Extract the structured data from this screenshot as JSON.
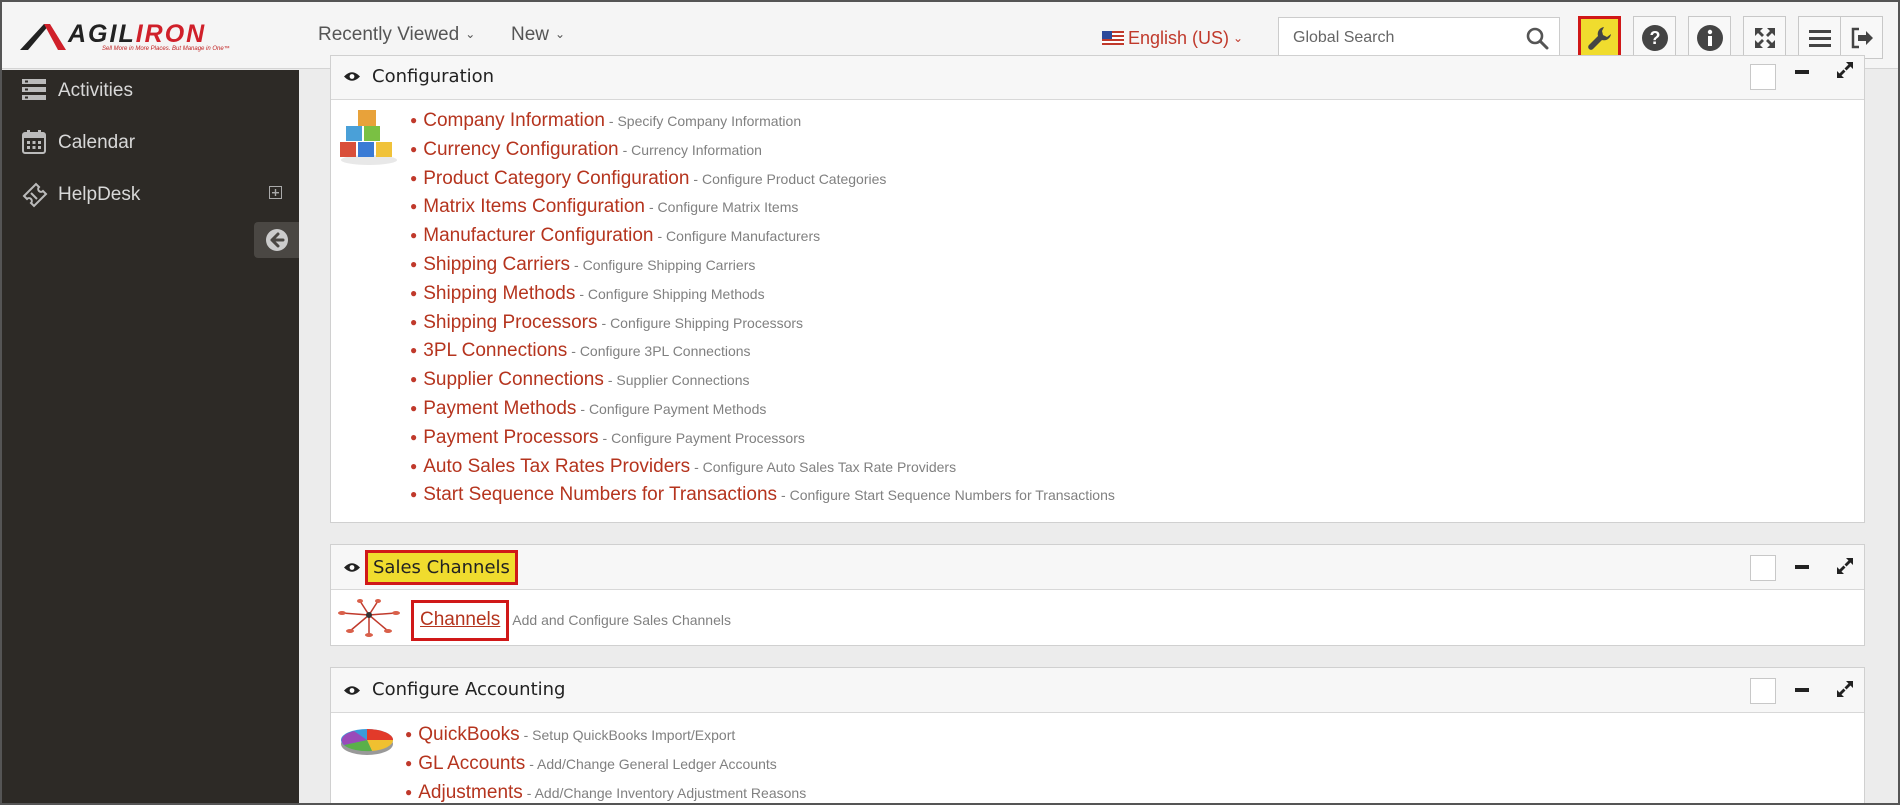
{
  "brand": {
    "name_part1": "AGIL",
    "name_part2": "IRON",
    "tagline": "Sell More in More Places. But Manage in One™"
  },
  "topbar": {
    "recently_viewed": "Recently Viewed",
    "new_label": "New",
    "language": "English (US)",
    "search_placeholder": "Global Search",
    "buttons": [
      "settings-wrench",
      "help",
      "info",
      "fullscreen",
      "menu",
      "logout"
    ]
  },
  "sidebar": {
    "items": [
      {
        "label": "Activities",
        "icon": "activities-icon"
      },
      {
        "label": "Calendar",
        "icon": "calendar-icon"
      },
      {
        "label": "HelpDesk",
        "icon": "ticket-icon"
      }
    ]
  },
  "panels": {
    "configuration": {
      "title": "Configuration",
      "items": [
        {
          "link": "Company Information",
          "desc": "- Specify Company Information"
        },
        {
          "link": "Currency Configuration",
          "desc": "- Currency Information"
        },
        {
          "link": "Product Category Configuration",
          "desc": "- Configure Product Categories"
        },
        {
          "link": "Matrix Items Configuration",
          "desc": "- Configure Matrix Items"
        },
        {
          "link": "Manufacturer Configuration",
          "desc": "- Configure Manufacturers"
        },
        {
          "link": "Shipping Carriers",
          "desc": "- Configure Shipping Carriers"
        },
        {
          "link": "Shipping Methods",
          "desc": "- Configure Shipping Methods"
        },
        {
          "link": "Shipping Processors",
          "desc": "- Configure Shipping Processors"
        },
        {
          "link": "3PL Connections",
          "desc": "- Configure 3PL Connections"
        },
        {
          "link": "Supplier Connections",
          "desc": "- Supplier Connections"
        },
        {
          "link": "Payment Methods",
          "desc": "- Configure Payment Methods"
        },
        {
          "link": "Payment Processors",
          "desc": "- Configure Payment Processors"
        },
        {
          "link": "Auto Sales Tax Rates Providers",
          "desc": "- Configure Auto Sales Tax Rate Providers"
        },
        {
          "link": "Start Sequence Numbers for Transactions",
          "desc": "- Configure Start Sequence Numbers for Transactions"
        }
      ]
    },
    "sales_channels": {
      "title": "Sales Channels",
      "items": [
        {
          "link": "Channels",
          "desc": "Add and Configure Sales Channels"
        }
      ]
    },
    "accounting": {
      "title": "Configure Accounting",
      "items": [
        {
          "link": "QuickBooks",
          "desc": "- Setup QuickBooks Import/Export"
        },
        {
          "link": "GL Accounts",
          "desc": "- Add/Change General Ledger Accounts"
        },
        {
          "link": "Adjustments",
          "desc": "- Add/Change Inventory Adjustment Reasons"
        }
      ]
    }
  },
  "colors": {
    "accent": "#b5341e",
    "highlight": "#f0dc2e",
    "highlight_border": "#d01818",
    "sidebar": "#2d2a26"
  }
}
